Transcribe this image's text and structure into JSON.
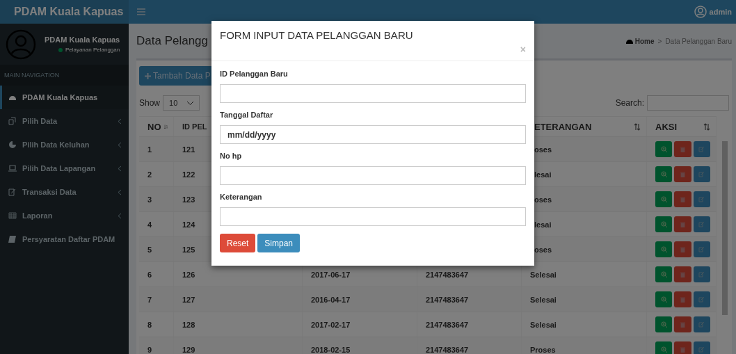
{
  "header": {
    "brand": "PDAM Kuala Kapuas",
    "user": "admin"
  },
  "sidebar": {
    "user_name": "PDAM Kuala Kapuas",
    "status": "Pelayanan Pelanggan",
    "section": "MAIN NAVIGATION",
    "items": [
      {
        "label": "PDAM Kuala Kapuas",
        "selected": true
      },
      {
        "label": "Pilih Data",
        "selected": false,
        "expanded": false
      },
      {
        "label": "Pilih Data Keluhan",
        "selected": false,
        "expanded": false
      },
      {
        "label": "Pilih Data Lapangan",
        "selected": false,
        "expanded": false
      },
      {
        "label": "Transaksi Data",
        "selected": false,
        "expanded": false
      },
      {
        "label": "Laporan",
        "selected": false,
        "expanded": false
      },
      {
        "label": "Persyaratan Daftar PDAM",
        "selected": false
      }
    ]
  },
  "content": {
    "title": "Data Pelangg",
    "breadcrumb": {
      "items": [
        "Home",
        "Data Pelanggan Baru"
      ],
      "separator": ">"
    },
    "add_button": "Tambah Data P",
    "show_label": "Show",
    "page_size": "10",
    "search_label": "Search:",
    "table": {
      "columns": [
        {
          "label": "NO",
          "sorted": true
        },
        {
          "label": "ID PEL"
        },
        null,
        null,
        {
          "label": "ETERANGAN",
          "sorted": false
        },
        {
          "label": "AKSI",
          "sorted": false
        }
      ],
      "rows": [
        {
          "no": "1",
          "id": "121",
          "keterangan": "oses"
        },
        {
          "no": "2",
          "id": "122",
          "keterangan": "lesai"
        },
        {
          "no": "3",
          "id": "123",
          "keterangan": "oses"
        },
        {
          "no": "4",
          "id": "124",
          "keterangan": "lesai"
        },
        {
          "no": "5",
          "id": "125",
          "keterangan": "oses"
        },
        {
          "no": "6",
          "id": "126",
          "tanggal": "2017-06-17",
          "no_hp": "2147483647",
          "keterangan": "Selesai"
        },
        {
          "no": "7",
          "id": "127",
          "tanggal": "2016-04-17",
          "no_hp": "2147483647",
          "keterangan": "Selesai"
        },
        {
          "no": "8",
          "id": "128",
          "tanggal": "2017-02-17",
          "no_hp": "2147483647",
          "keterangan": "Selesai"
        },
        {
          "no": "9",
          "id": "129",
          "tanggal": "2018-02-15",
          "no_hp": "2147483647",
          "keterangan": "Proses"
        }
      ]
    }
  },
  "modal": {
    "title": "FORM INPUT DATA PELANGGAN BARU",
    "close": "×",
    "fields": [
      {
        "label": "ID Pelanggan Baru"
      },
      {
        "label": "Tanggal Daftar",
        "placeholder": "mm/dd/yyyy"
      },
      {
        "label": "No hp"
      },
      {
        "label": "Keterangan"
      }
    ],
    "buttons": [
      {
        "label": "Reset",
        "kind": "danger"
      },
      {
        "label": "Simpan",
        "kind": "primary"
      }
    ]
  }
}
